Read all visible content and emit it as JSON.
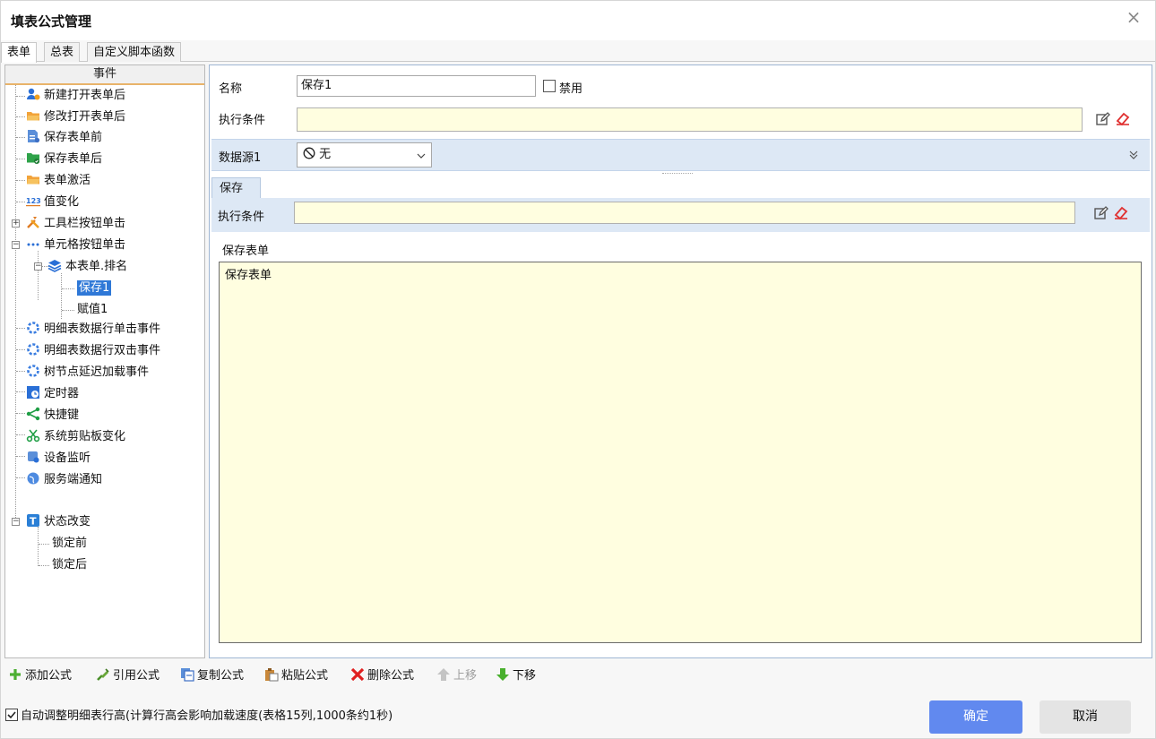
{
  "window": {
    "title": "填表公式管理",
    "close_glyph": "×"
  },
  "top_tabs": [
    "表单",
    "总表",
    "自定义脚本函数"
  ],
  "tree": {
    "header": "事件",
    "nodes": [
      {
        "label": "新建打开表单后",
        "icon": "user-add-icon"
      },
      {
        "label": "修改打开表单后",
        "icon": "folder-open-icon"
      },
      {
        "label": "保存表单前",
        "icon": "document-save-icon"
      },
      {
        "label": "保存表单后",
        "icon": "folder-check-icon"
      },
      {
        "label": "表单激活",
        "icon": "folder-open-icon"
      },
      {
        "label": "值变化",
        "icon": "numbers-icon"
      },
      {
        "label": "工具栏按钮单击",
        "icon": "tools-icon"
      },
      {
        "label": "单元格按钮单击",
        "icon": "dots-icon"
      },
      {
        "label": "本表单.排名",
        "icon": "layers-icon"
      },
      {
        "label": "保存1",
        "icon": ""
      },
      {
        "label": "赋值1",
        "icon": ""
      },
      {
        "label": "明细表数据行单击事件",
        "icon": "spinner-icon"
      },
      {
        "label": "明细表数据行双击事件",
        "icon": "spinner-icon"
      },
      {
        "label": "树节点延迟加载事件",
        "icon": "spinner-icon"
      },
      {
        "label": "定时器",
        "icon": "timer-icon"
      },
      {
        "label": "快捷键",
        "icon": "share-icon"
      },
      {
        "label": "系统剪贴板变化",
        "icon": "scissors-icon"
      },
      {
        "label": "设备监听",
        "icon": "device-icon"
      },
      {
        "label": "服务端通知",
        "icon": "globe-icon"
      },
      {
        "label": "状态改变",
        "icon": "t-badge-icon"
      },
      {
        "label": "锁定前",
        "icon": ""
      },
      {
        "label": "锁定后",
        "icon": ""
      }
    ]
  },
  "form": {
    "name_label": "名称",
    "name_value": "保存1",
    "disable_label": "禁用",
    "condition_label": "执行条件",
    "condition_value": "",
    "datasource_label": "数据源1",
    "datasource_value": "无",
    "inner_tab": "保存",
    "inner_condition_label": "执行条件",
    "inner_condition_value": "",
    "action_label": "保存表单",
    "action_text": "保存表单"
  },
  "toolbar": {
    "add": "添加公式",
    "ref": "引用公式",
    "copy": "复制公式",
    "paste": "粘贴公式",
    "delete": "删除公式",
    "up": "上移",
    "down": "下移"
  },
  "footer": {
    "auto_adjust": "自动调整明细表行高(计算行高会影响加载速度(表格15列,1000条约1秒)",
    "ok": "确定",
    "cancel": "取消"
  },
  "colors": {
    "accent": "#6189ef",
    "selection": "#2f78d7",
    "formula_bg": "#fffee0",
    "datasource_bar": "#dde8f5"
  }
}
